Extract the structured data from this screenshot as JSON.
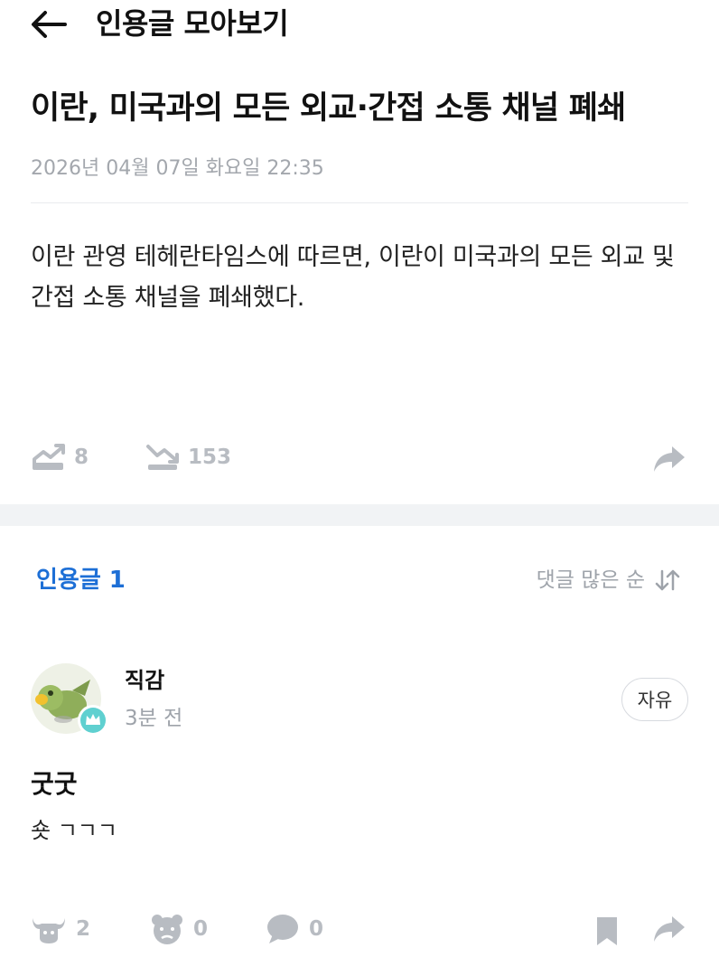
{
  "header": {
    "title": "인용글 모아보기"
  },
  "article": {
    "title": "이란, 미국과의 모든 외교·간접 소통 채널 폐쇄",
    "date": "2026년 04월 07일 화요일 22:35",
    "body": "이란 관영 테헤란타임스에 따르면, 이란이 미국과의 모든 외교 및 간접 소통 채널을 폐쇄했다.",
    "stats": {
      "up_count": "8",
      "down_count": "153"
    }
  },
  "quotes": {
    "count_label": "인용글 1",
    "sort_label": "댓글 많은 순"
  },
  "post": {
    "author": "직감",
    "time": "3분 전",
    "tag": "자유",
    "title": "굿굿",
    "body": "숏 ㄱㄱㄱ",
    "reactions": {
      "bull": "2",
      "bear": "0",
      "comments": "0"
    }
  },
  "colors": {
    "accent": "#1d6fd6",
    "muted": "#b8bcc2",
    "section_bg": "#f1f3f5"
  }
}
